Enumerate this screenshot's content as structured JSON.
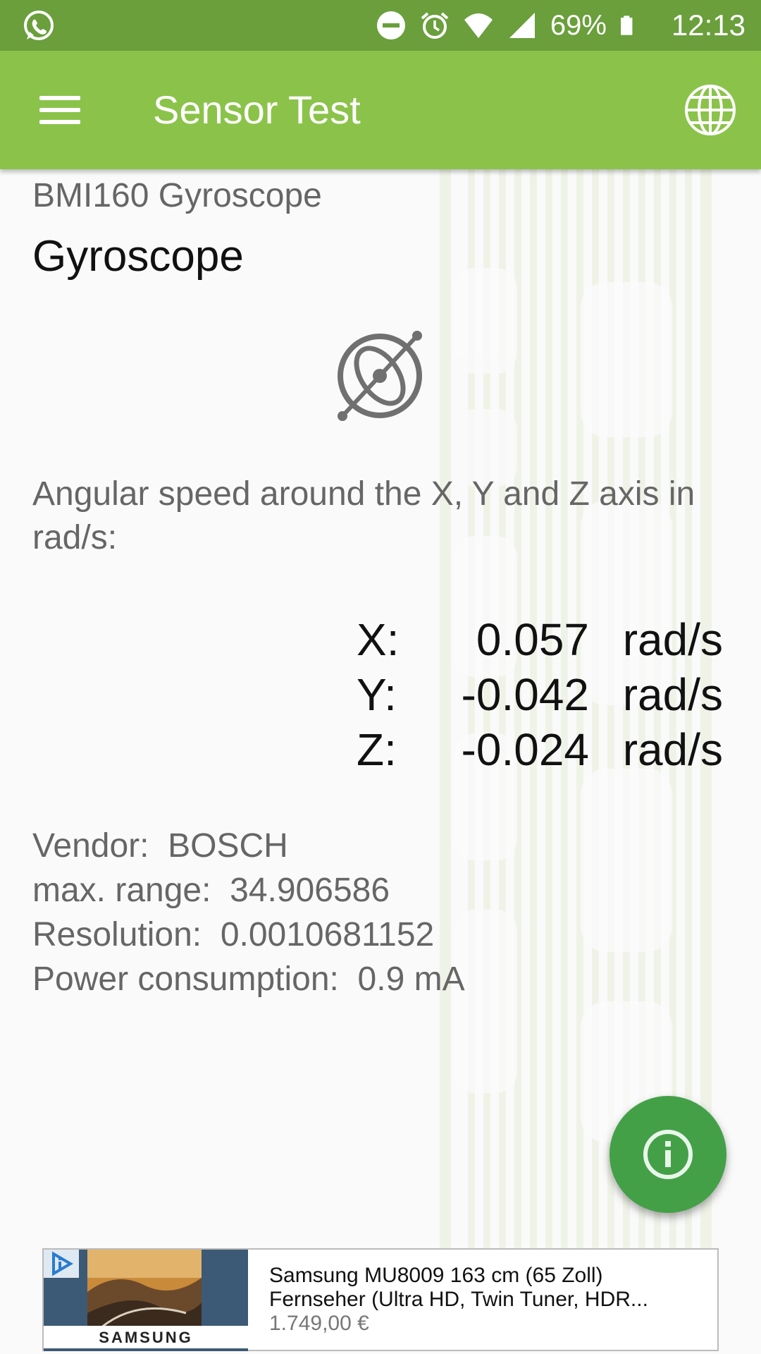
{
  "status_bar": {
    "battery_percent": "69%",
    "time": "12:13",
    "icons": [
      "whatsapp-icon",
      "do-not-disturb-icon",
      "alarm-icon",
      "wifi-icon",
      "signal-icon",
      "battery-icon"
    ]
  },
  "app_bar": {
    "title": "Sensor Test",
    "menu_icon": "hamburger-menu-icon",
    "action_icon": "globe-icon"
  },
  "sensor": {
    "name": "BMI160 Gyroscope",
    "type": "Gyroscope",
    "icon": "gyroscope-icon",
    "description": "Angular speed around the X, Y and Z axis in rad/s:",
    "readings": [
      {
        "axis": "X:",
        "value": "0.057",
        "unit": "rad/s"
      },
      {
        "axis": "Y:",
        "value": "-0.042",
        "unit": "rad/s"
      },
      {
        "axis": "Z:",
        "value": "-0.024",
        "unit": "rad/s"
      }
    ],
    "specs": [
      "Vendor:  BOSCH",
      "max. range:  34.906586",
      "Resolution:  0.0010681152",
      "Power consumption:  0.9 mA"
    ]
  },
  "fab": {
    "icon": "info-icon"
  },
  "ad": {
    "brand": "SAMSUNG",
    "title_line1": "Samsung MU8009 163 cm (65 Zoll)",
    "title_line2": "Fernseher (Ultra HD, Twin Tuner, HDR...",
    "price": "1.749,00 €"
  },
  "colors": {
    "status_bar": "#6a9f3c",
    "app_bar": "#8bc34a",
    "fab": "#43a047",
    "background": "#fafafa"
  }
}
